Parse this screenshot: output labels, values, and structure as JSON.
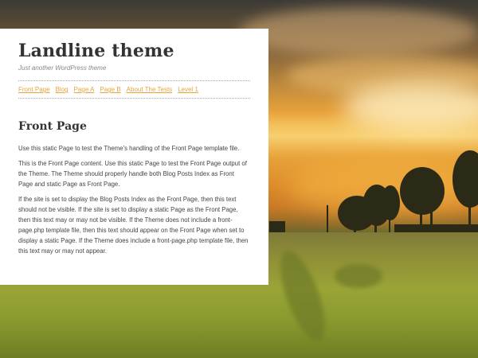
{
  "site": {
    "title": "Landline theme",
    "tagline": "Just another WordPress theme"
  },
  "nav": {
    "items": [
      {
        "label": "Front Page"
      },
      {
        "label": "Blog"
      },
      {
        "label": "Page A"
      },
      {
        "label": "Page B"
      },
      {
        "label": "About The Tests"
      },
      {
        "label": "Level 1"
      }
    ]
  },
  "content": {
    "title": "Front Page",
    "paragraphs": [
      "Use this static Page to test the Theme's handling of the Front Page template file.",
      "This is the Front Page content. Use this static Page to test the Front Page output of the Theme. The Theme should properly handle both Blog Posts Index as Front Page and static Page as Front Page.",
      "If the site is set to display the Blog Posts Index as the Front Page, then this text should not be visible. If the site is set to display a static Page as the Front Page, then this text may or may not be visible. If the Theme does not include a front-page.php template file, then this text should appear on the Front Page when set to display a static Page. If the Theme does include a front-page.php template file, then this text may or may not appear."
    ]
  },
  "colors": {
    "link": "#e8a33a",
    "title": "#333333",
    "text": "#444444"
  }
}
